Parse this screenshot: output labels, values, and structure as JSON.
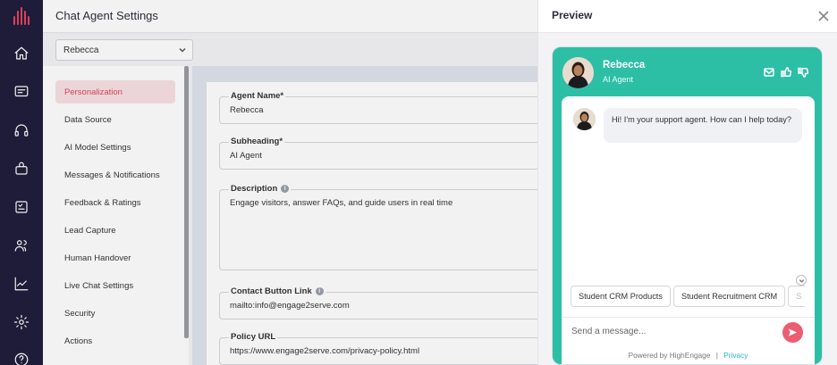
{
  "header": {
    "title": "Chat Agent Settings"
  },
  "agent_select": {
    "value": "Rebecca"
  },
  "menu": [
    {
      "label": "Personalization",
      "active": true
    },
    {
      "label": "Data Source"
    },
    {
      "label": "AI Model Settings"
    },
    {
      "label": "Messages & Notifications"
    },
    {
      "label": "Feedback & Ratings"
    },
    {
      "label": "Lead Capture"
    },
    {
      "label": "Human Handover"
    },
    {
      "label": "Live Chat Settings"
    },
    {
      "label": "Security"
    },
    {
      "label": "Actions"
    }
  ],
  "form": {
    "agent_name": {
      "label": "Agent Name*",
      "value": "Rebecca"
    },
    "subheading": {
      "label": "Subheading*",
      "value": "AI Agent"
    },
    "description": {
      "label": "Description",
      "value": "Engage visitors, answer FAQs, and guide users in real time"
    },
    "contact_link": {
      "label": "Contact Button Link",
      "value": "mailto:info@engage2serve.com"
    },
    "policy_url": {
      "label": "Policy URL",
      "value": "https://www.engage2serve.com/privacy-policy.html"
    }
  },
  "preview": {
    "title": "Preview",
    "agent_name": "Rebecca",
    "agent_sub": "AI Agent",
    "greeting": "Hi! I'm your support agent. How can I help today?",
    "chips": [
      "Student CRM Products",
      "Student Recruitment CRM",
      "S"
    ],
    "input_placeholder": "Send a message...",
    "powered_by": "Powered by HighEngage",
    "separator": "|",
    "privacy": "Privacy"
  },
  "colors": {
    "rail": "#1f1c3b",
    "accent": "#2cbfa6",
    "active": "#d9475c",
    "send": "#ec5d72"
  },
  "icons": [
    "logo-icon",
    "home-icon",
    "message-icon",
    "headset-icon",
    "bag-icon",
    "checklist-icon",
    "users-icon",
    "chart-icon",
    "settings-icon",
    "help-icon"
  ]
}
